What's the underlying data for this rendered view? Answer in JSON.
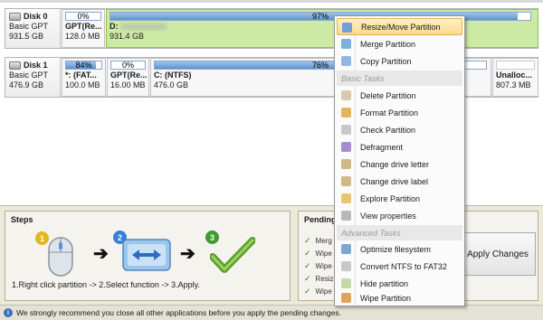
{
  "disks": [
    {
      "name": "Disk 0",
      "type": "Basic GPT",
      "size": "931.5 GB",
      "partitions": [
        {
          "label": "GPT(Re...",
          "size": "128.0 MB",
          "usage": "0%"
        },
        {
          "label": "D:",
          "size": "931.4 GB",
          "usage": "97%",
          "selected": true
        }
      ]
    },
    {
      "name": "Disk 1",
      "type": "Basic GPT",
      "size": "476.9 GB",
      "partitions": [
        {
          "label": "*: (FAT...",
          "size": "100.0 MB",
          "usage": "84%"
        },
        {
          "label": "GPT(Re...",
          "size": "16.00 MB",
          "usage": "0%"
        },
        {
          "label": "C: (NTFS)",
          "size": "476.0 GB",
          "usage": "76%"
        },
        {
          "label": "Unalloc...",
          "size": "807.3 MB"
        }
      ]
    }
  ],
  "steps": {
    "title": "Steps",
    "numbers": [
      "1",
      "2",
      "3"
    ],
    "caption": "1.Right click partition -> 2.Select function -> 3.Apply."
  },
  "pending": {
    "title": "Pending",
    "items": [
      "Merg",
      "Wipe",
      "Wipe",
      "Resiz",
      "Wipe"
    ],
    "apply_label": "Apply Changes"
  },
  "status": {
    "message": "We strongly recommend you close all other applications before you apply the pending changes."
  },
  "context_menu": {
    "items": [
      {
        "label": "Resize/Move Partition",
        "icon": "resize-icon",
        "highlighted": true
      },
      {
        "label": "Merge Partition",
        "icon": "merge-icon"
      },
      {
        "label": "Copy Partition",
        "icon": "copy-icon"
      },
      {
        "header": "Basic Tasks"
      },
      {
        "label": "Delete Partition",
        "icon": "delete-icon"
      },
      {
        "label": "Format Partition",
        "icon": "format-icon"
      },
      {
        "label": "Check Partition",
        "icon": "check-icon"
      },
      {
        "label": "Defragment",
        "icon": "defragment-icon"
      },
      {
        "label": "Change drive letter",
        "icon": "drive-letter-icon"
      },
      {
        "label": "Change drive label",
        "icon": "drive-label-icon"
      },
      {
        "label": "Explore Partition",
        "icon": "explore-icon"
      },
      {
        "label": "View properties",
        "icon": "properties-icon"
      },
      {
        "header": "Advanced Tasks"
      },
      {
        "label": "Optimize filesystem",
        "icon": "optimize-icon"
      },
      {
        "label": "Convert NTFS to FAT32",
        "icon": "convert-icon"
      },
      {
        "label": "Hide partition",
        "icon": "hide-icon"
      },
      {
        "label": "Wipe Partition",
        "icon": "wipe-icon"
      }
    ]
  },
  "colors": {
    "selected_partition": "#cdeaa5",
    "usage_bar": "#5e93cf",
    "menu_highlight": "#fdd88a"
  }
}
